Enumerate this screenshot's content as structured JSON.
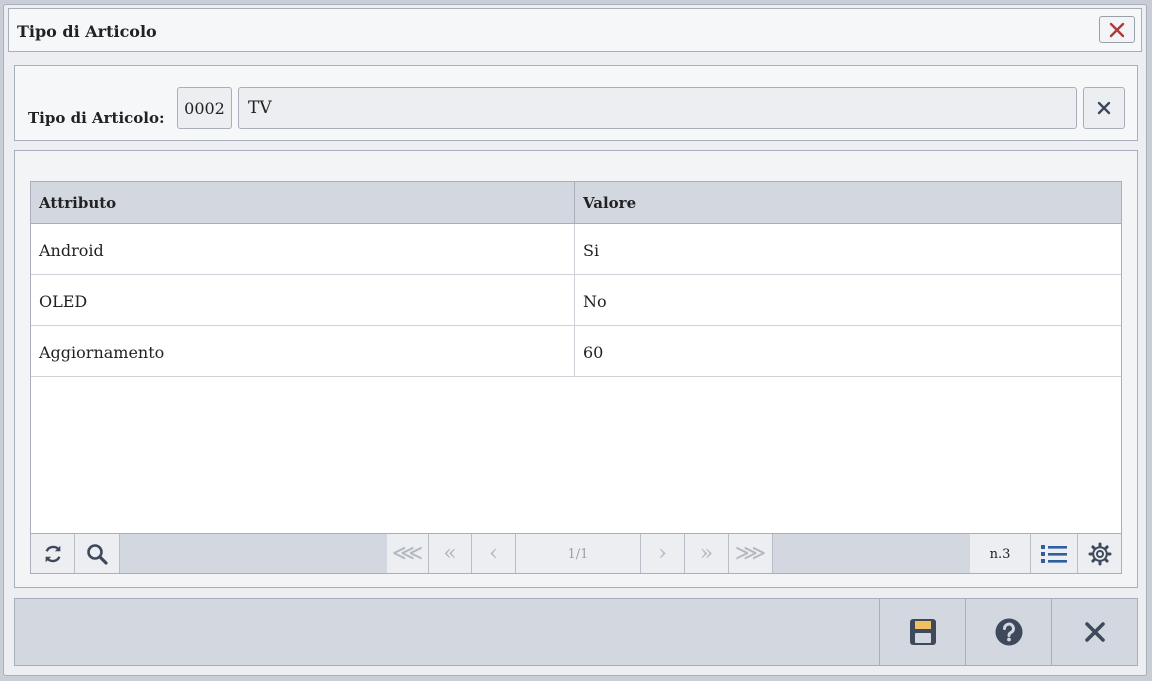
{
  "window": {
    "title": "Tipo di Articolo"
  },
  "header": {
    "label": "Tipo di Articolo:",
    "code": "0002",
    "description": "TV"
  },
  "grid": {
    "columns": [
      "Attributo",
      "Valore"
    ],
    "rows": [
      {
        "attribute": "Android",
        "value": "Si"
      },
      {
        "attribute": "OLED",
        "value": "No"
      },
      {
        "attribute": "Aggiornamento",
        "value": "60"
      }
    ]
  },
  "pager": {
    "page": "1/1",
    "count": "n.3",
    "buttons": [
      "first",
      "previous-block",
      "previous",
      "next",
      "next-block",
      "last"
    ]
  },
  "footer": {
    "buttons": [
      "save",
      "help",
      "close"
    ]
  },
  "colors": {
    "accent_dark": "#3e4a5c",
    "close_red": "#b03a3a",
    "save_tab": "#f0c060",
    "list_icon_blue": "#2f5f9e"
  },
  "icons": [
    "close-icon",
    "clear-icon",
    "refresh-icon",
    "search-icon",
    "list-icon",
    "gear-icon",
    "save-icon",
    "help-icon",
    "cancel-icon"
  ]
}
